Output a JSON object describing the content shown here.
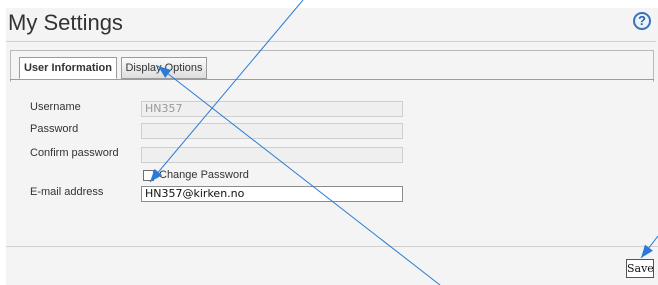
{
  "title": "My Settings",
  "help_icon": {
    "name": "help-icon",
    "glyph": "?"
  },
  "tabs": [
    {
      "label": "User Information",
      "active": true
    },
    {
      "label": "Display Options",
      "active": false
    }
  ],
  "form": {
    "username_label": "Username",
    "username_value": "HN357",
    "password_label": "Password",
    "password_value": "",
    "confirm_label": "Confirm password",
    "confirm_value": "",
    "change_password_label": "Change Password",
    "change_password_checked": false,
    "email_label": "E-mail address",
    "email_value": "HN357@kirken.no"
  },
  "save_label": "Save",
  "annotation_color": "#2b7bd6"
}
